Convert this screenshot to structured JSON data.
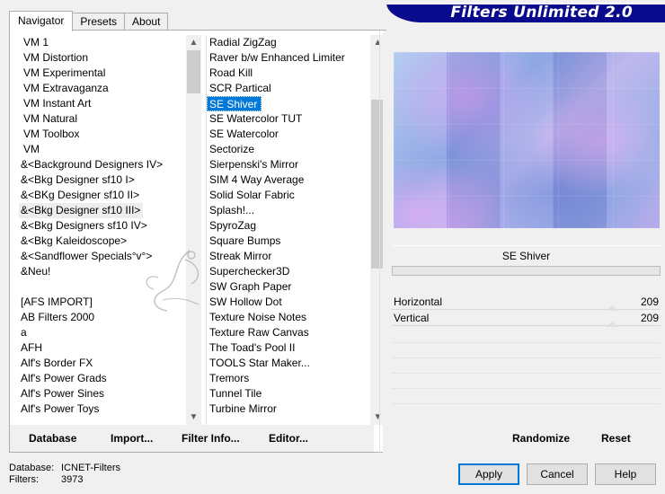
{
  "tabs": [
    {
      "label": "Navigator",
      "active": true
    },
    {
      "label": "Presets",
      "active": false
    },
    {
      "label": "About",
      "active": false
    }
  ],
  "banner": {
    "title": "Filters Unlimited 2.0"
  },
  "categories": [
    "VM 1",
    "VM Distortion",
    "VM Experimental",
    "VM Extravaganza",
    "VM Instant Art",
    "VM Natural",
    "VM Toolbox",
    "VM",
    "&<Background Designers IV>",
    "&<Bkg Designer sf10 I>",
    "&<BKg Designer sf10 II>",
    "&<Bkg Designer sf10 III>",
    "&<Bkg Designers sf10 IV>",
    "&<Bkg Kaleidoscope>",
    "&<Sandflower Specials°v°>",
    "&Neu!",
    "",
    "[AFS IMPORT]",
    "AB Filters 2000",
    "a",
    "AFH",
    "Alf's Border FX",
    "Alf's Power Grads",
    "Alf's Power Sines",
    "Alf's Power Toys"
  ],
  "category_hover_index": 11,
  "filters": [
    "Radial ZigZag",
    "Raver b/w Enhanced Limiter",
    "Road Kill",
    "SCR  Partical",
    "SE Shiver",
    "SE Watercolor TUT",
    "SE Watercolor",
    "Sectorize",
    "Sierpenski's Mirror",
    "SIM 4 Way Average",
    "Solid Solar Fabric",
    "Splash!...",
    "SpyroZag",
    "Square Bumps",
    "Streak Mirror",
    "Superchecker3D",
    "SW Graph Paper",
    "SW Hollow Dot",
    "Texture Noise Notes",
    "Texture Raw Canvas",
    "The Toad's Pool II",
    "TOOLS Star Maker...",
    "Tremors",
    "Tunnel Tile",
    "Turbine Mirror"
  ],
  "filter_selected_index": 4,
  "current_filter": "SE Shiver",
  "sliders": [
    {
      "label": "Horizontal",
      "value": "209",
      "fraction": 0.82
    },
    {
      "label": "Vertical",
      "value": "209",
      "fraction": 0.82
    }
  ],
  "left_buttons": {
    "database": "Database",
    "import": "Import...",
    "filter_info": "Filter Info...",
    "editor": "Editor..."
  },
  "right_buttons": {
    "randomize": "Randomize",
    "reset": "Reset"
  },
  "footer": {
    "database_label": "Database:",
    "database_value": "ICNET-Filters",
    "filters_label": "Filters:",
    "filters_value": "3973"
  },
  "dialog_buttons": {
    "apply": "Apply",
    "cancel": "Cancel",
    "help": "Help"
  },
  "colors": {
    "banner": "#0a0a8c",
    "selection": "#0078d7"
  }
}
